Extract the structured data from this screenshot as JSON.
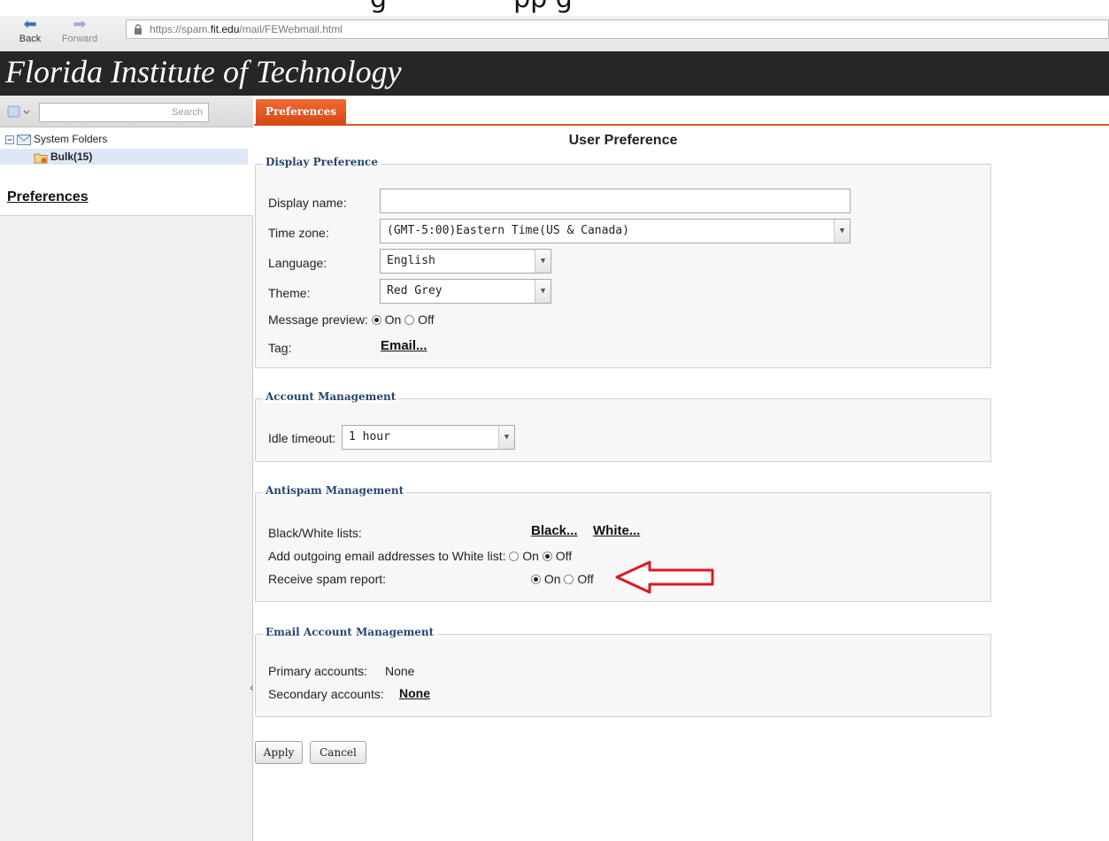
{
  "header_fragment": "g               pp g",
  "browser": {
    "back_label": "Back",
    "forward_label": "Forward",
    "url_prefix": "https://spam.",
    "url_domain": "fit.edu",
    "url_path": "/mail/FEWebmail.html"
  },
  "app": {
    "title": "Florida Institute of Technology"
  },
  "sidebar": {
    "search_label": "Search",
    "folders": {
      "root_label": "System Folders",
      "bulk_label": "Bulk(15)"
    },
    "preferences_link": "Preferences"
  },
  "tabs": [
    {
      "label": "Preferences"
    }
  ],
  "page_title": "User Preference",
  "display_pref": {
    "legend": "Display Preference",
    "display_name_label": "Display name:",
    "display_name_value": "",
    "time_zone_label": "Time zone:",
    "time_zone_value": "(GMT-5:00)Eastern Time(US & Canada)",
    "language_label": "Language:",
    "language_value": "English",
    "theme_label": "Theme:",
    "theme_value": "Red Grey",
    "preview_label": "Message preview:",
    "preview_on": "On",
    "preview_off": "Off",
    "tag_label": "Tag:",
    "tag_link": "Email..."
  },
  "account_mgmt": {
    "legend": "Account Management",
    "idle_label": "Idle timeout:",
    "idle_value": "1 hour"
  },
  "antispam": {
    "legend": "Antispam Management",
    "bw_label": "Black/White lists:",
    "black_link": "Black...",
    "white_link": "White...",
    "outgoing_label": "Add outgoing email addresses to White list:",
    "outgoing_on": "On",
    "outgoing_off": "Off",
    "report_label": "Receive spam report:",
    "report_on": "On",
    "report_off": "Off"
  },
  "email_accounts": {
    "legend": "Email Account Management",
    "primary_label": "Primary accounts:",
    "primary_value": "None",
    "secondary_label": "Secondary accounts:",
    "secondary_value": "None"
  },
  "buttons": {
    "apply": "Apply",
    "cancel": "Cancel"
  },
  "colors": {
    "accent": "#e0591c",
    "arrow": "#d91a20",
    "legend": "#26476f"
  }
}
